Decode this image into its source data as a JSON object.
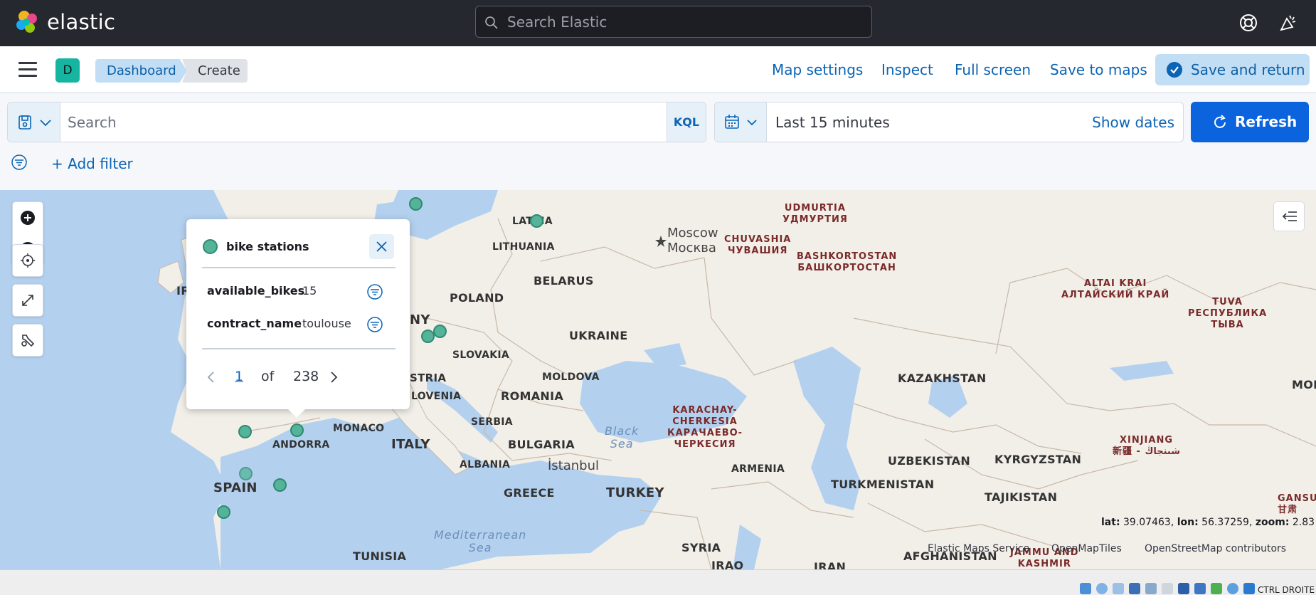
{
  "header": {
    "brand": "elastic",
    "search_placeholder": "Search Elastic",
    "help_icon": "help-icon",
    "news_icon": "newsfeed-icon"
  },
  "subnav": {
    "space_initial": "D",
    "breadcrumbs": [
      "Dashboard",
      "Create"
    ],
    "links": [
      "Map settings",
      "Inspect",
      "Full screen",
      "Save to maps"
    ],
    "primary_action": "Save and return"
  },
  "query": {
    "search_placeholder": "Search",
    "language": "KQL",
    "time_range": "Last 15 minutes",
    "show_dates": "Show dates",
    "refresh_label": "Refresh",
    "add_filter": "+ Add filter"
  },
  "map": {
    "labels": {
      "latvia": "LATVIA",
      "lithuania": "LITHUANIA",
      "belarus": "BELARUS",
      "poland": "POLAND",
      "ukraine": "UKRAINE",
      "slovakia": "SLOVAKIA",
      "moldova": "MOLDOVA",
      "romania": "ROMANIA",
      "serbia": "SERBIA",
      "bulgaria": "BULGARIA",
      "albania": "ALBANIA",
      "greece": "GREECE",
      "turkey": "TURKEY",
      "italy": "ITALY",
      "monaco": "MONACO",
      "andorra": "ANDORRA",
      "spain": "SPAIN",
      "tunisia": "TUNISIA",
      "syria": "SYRIA",
      "iraq": "IRAQ",
      "iran": "IRAN",
      "armenia": "ARMENIA",
      "kazakhstan": "KAZAKHSTAN",
      "uzbekistan": "UZBEKISTAN",
      "kyrgyzstan": "KYRGYZSTAN",
      "turkmenistan": "TURKMENISTAN",
      "tajikistan": "TAJIKISTAN",
      "afghanistan": "AFGHANISTAN",
      "mon": "MON",
      "ir": "IR",
      "ny": "NY",
      "stria": "STRIA",
      "lovenia": "LOVENIA",
      "moscow": "Moscow",
      "moscow_ru": "Москва",
      "istanbul": "İstanbul",
      "black_sea_1": "Black",
      "black_sea_2": "Sea",
      "med_sea_1": "Mediterranean",
      "med_sea_2": "Sea",
      "udmurtia_1": "UDMURTIA",
      "udmurtia_2": "УДМУРТИЯ",
      "chuvashia_1": "CHUVASHIA",
      "chuvashia_2": "ЧУВАШИЯ",
      "bashkortostan_1": "BASHKORTOSTAN",
      "bashkortostan_2": "БАШКОРТОСТАН",
      "altai_1": "ALTAI KRAI",
      "altai_2": "АЛТАЙСКИЙ КРАЙ",
      "tuva_1": "TUVA",
      "tuva_2": "РЕСПУБЛИКА",
      "tuva_3": "ТЫВА",
      "karachay_1": "KARACHAY-",
      "karachay_2": "CHERKESIA",
      "karachay_3": "КАРАЧАЕВО-",
      "karachay_4": "ЧЕРКЕСИЯ",
      "xinjiang_1": "XINJIANG",
      "xinjiang_2": "新疆 - شىنجاڭ",
      "gansu_1": "GANSU PR",
      "gansu_2": "甘肃",
      "jammu_1": "JAMMU AND",
      "jammu_2": "KASHMIR"
    },
    "coords": {
      "lat_label": "lat:",
      "lat": "39.07463",
      "lon_label": "lon:",
      "lon": "56.37259",
      "zoom_label": "zoom:",
      "zoom": "2.83"
    },
    "attribution": [
      "Elastic Maps Service",
      "OpenMapTiles",
      "OpenStreetMap contributors"
    ]
  },
  "popup": {
    "layer_name": "bike stations",
    "fields": [
      {
        "key": "available_bikes",
        "value": "15"
      },
      {
        "key": "contract_name",
        "value": "toulouse"
      }
    ],
    "page_current": "1",
    "page_of": "of",
    "page_total": "238"
  },
  "taskbar": {
    "status_text": "CTRL DROITE"
  },
  "colors": {
    "header_bg": "#25282f",
    "accent": "#0b64dd",
    "point_fill": "#54b399",
    "water": "#b3d1ef",
    "land": "#f2efe9"
  }
}
